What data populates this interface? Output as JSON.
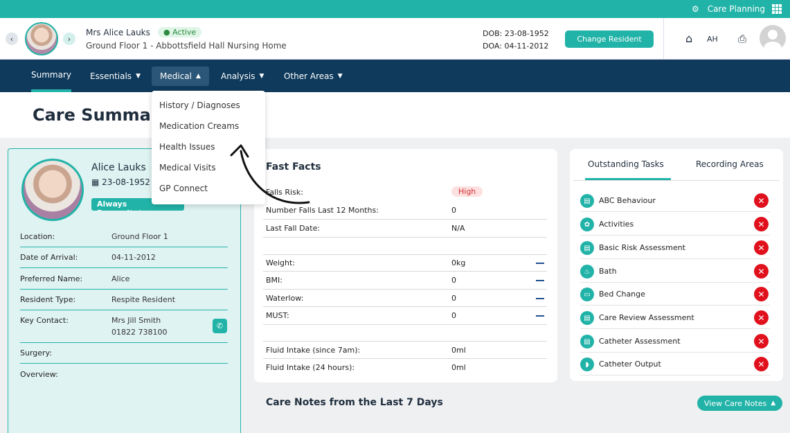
{
  "topbar": {
    "title": "Care Planning"
  },
  "header": {
    "resident_name": "Mrs Alice Lauks",
    "status": "Active",
    "address": "Ground Floor 1 - Abbottsfield Hall Nursing Home",
    "dob": "DOB: 23-08-1952",
    "doa": "DOA: 04-11-2012",
    "change_button": "Change Resident",
    "user_initials": "AH"
  },
  "nav": {
    "items": [
      {
        "label": "Summary"
      },
      {
        "label": "Essentials"
      },
      {
        "label": "Medical"
      },
      {
        "label": "Analysis"
      },
      {
        "label": "Other Areas"
      }
    ]
  },
  "page": {
    "title": "Care Summar"
  },
  "dropdown": {
    "items": [
      "History / Diagnoses",
      "Medication Creams",
      "Health Issues",
      "Medical Visits",
      "GP Connect"
    ]
  },
  "profile": {
    "name": "Alice Lauks",
    "dob": "23-08-1952",
    "badge": "Always Resuscitate",
    "rows": [
      {
        "label": "Location:",
        "value": "Ground Floor 1"
      },
      {
        "label": "Date of Arrival:",
        "value": "04-11-2012"
      },
      {
        "label": "Preferred Name:",
        "value": "Alice"
      },
      {
        "label": "Resident Type:",
        "value": "Respite Resident"
      },
      {
        "label": "Key Contact:",
        "value": "Mrs Jill Smith",
        "value2": "01822 738100"
      },
      {
        "label": "Surgery:",
        "value": ""
      },
      {
        "label": "Overview:",
        "value": ""
      }
    ]
  },
  "fast_facts": {
    "title": "Fast Facts",
    "falls_risk_label": "Falls Risk:",
    "falls_risk_value": "High",
    "rows": [
      {
        "label": "Number Falls Last 12 Months:",
        "value": "0"
      },
      {
        "label": "Last Fall Date:",
        "value": "N/A"
      },
      {
        "label": "Weight:",
        "value": "0kg"
      },
      {
        "label": "BMI:",
        "value": "0"
      },
      {
        "label": "Waterlow:",
        "value": "0"
      },
      {
        "label": "MUST:",
        "value": "0"
      },
      {
        "label": "Fluid Intake (since 7am):",
        "value": "0ml"
      },
      {
        "label": "Fluid Intake (24 hours):",
        "value": "0ml"
      }
    ]
  },
  "tasks": {
    "tabs": [
      "Outstanding Tasks",
      "Recording Areas"
    ],
    "items": [
      "ABC Behaviour",
      "Activities",
      "Basic Risk Assessment",
      "Bath",
      "Bed Change",
      "Care Review Assessment",
      "Catheter Assessment",
      "Catheter Output"
    ]
  },
  "notes": {
    "title": "Care Notes from the Last 7 Days",
    "button": "View Care Notes"
  },
  "colors": {
    "accent": "#22b3a8",
    "nav": "#0f3a5c",
    "danger": "#e0101c"
  }
}
